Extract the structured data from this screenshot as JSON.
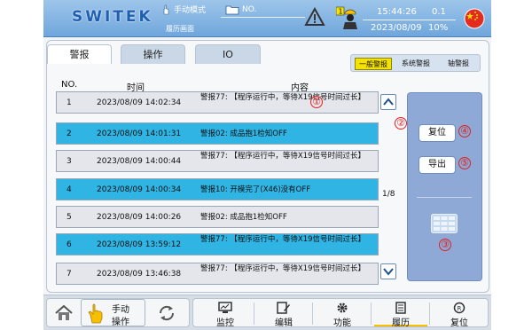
{
  "header": {
    "logo": "SWITEK",
    "mode": "手动模式",
    "page_name": "履历画面",
    "file": "NO.",
    "time": "15:44:26",
    "date": "2023/08/09",
    "value_top": "0.1",
    "value_bottom": "10%",
    "worker_badge": "1"
  },
  "tabs": [
    "警报",
    "操作",
    "IO"
  ],
  "filters": [
    "一般警报",
    "系统警报",
    "轴警报"
  ],
  "columns": {
    "no": "NO.",
    "time": "时间",
    "content": "内容"
  },
  "rows": [
    {
      "no": "1",
      "time": "2023/08/09 14:02:34",
      "msg": "警报77: 【程序运行中，等待X19信号时间过长】",
      "style": "gray"
    },
    {
      "no": "2",
      "time": "2023/08/09 14:01:31",
      "msg": "警报02: 成品抱1检知OFF",
      "style": "blue"
    },
    {
      "no": "3",
      "time": "2023/08/09 14:00:44",
      "msg": "警报77: 【程序运行中，等待X19信号时间过长】",
      "style": "gray"
    },
    {
      "no": "4",
      "time": "2023/08/09 14:00:34",
      "msg": "警报10: 开模完了(X46)没有OFF",
      "style": "blue"
    },
    {
      "no": "5",
      "time": "2023/08/09 14:00:26",
      "msg": "警报02: 成品抱1检知OFF",
      "style": "gray"
    },
    {
      "no": "6",
      "time": "2023/08/09 13:59:12",
      "msg": "警报77: 【程序运行中，等待X19信号时间过长】",
      "style": "blue"
    },
    {
      "no": "7",
      "time": "2023/08/09 13:46:38",
      "msg": "警报77: 【程序运行中，等待X19信号时间过长】",
      "style": "gray"
    }
  ],
  "page_indicator": "1/8",
  "actions": {
    "reset": "复位",
    "export": "导出"
  },
  "markers": [
    "①",
    "②",
    "③",
    "④",
    "⑤"
  ],
  "bottom": {
    "manual_line1": "手动",
    "manual_line2": "操作",
    "nav": [
      "监控",
      "编辑",
      "功能",
      "履历",
      "复位"
    ]
  },
  "colors": {
    "header": "#7fb0e0",
    "row_blue": "#2fb4e4",
    "row_gray": "#e4e6eb",
    "panel": "#8ea9d6",
    "selected_filter": "#f6e200",
    "marker": "#e02020"
  }
}
